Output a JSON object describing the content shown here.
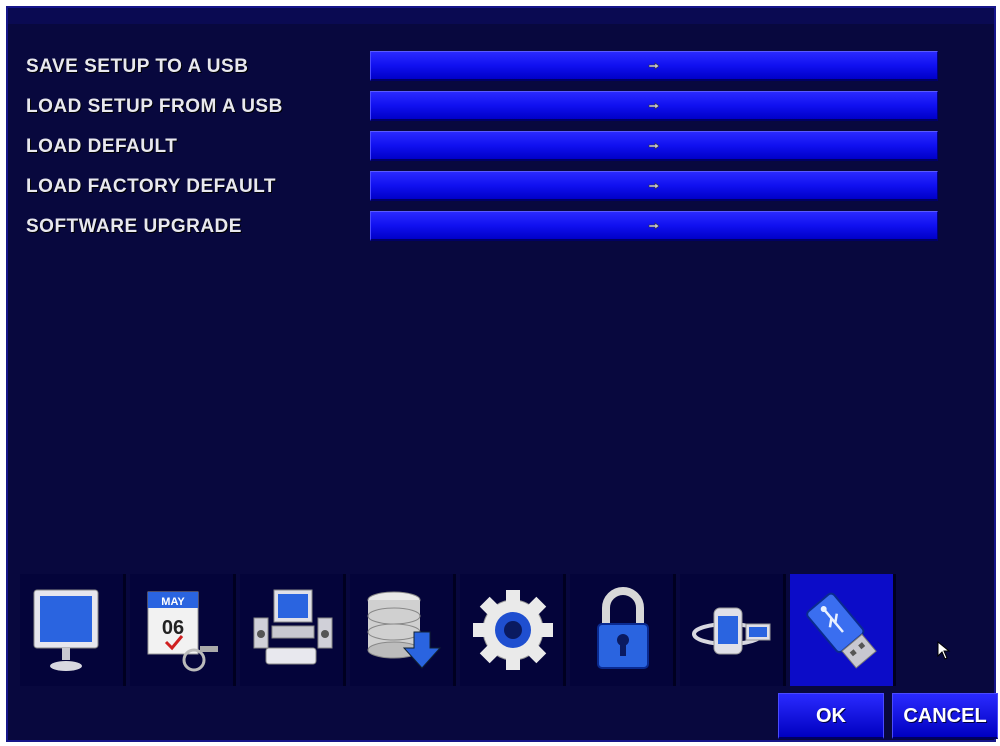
{
  "colors": {
    "background": "#08083e",
    "button": "#1010f0",
    "label": "#e8e8ee",
    "active_tab": "#0c0cc8"
  },
  "rows": [
    {
      "label": "SAVE SETUP TO A USB",
      "icon": "hand-pointer-icon"
    },
    {
      "label": "LOAD SETUP FROM A USB",
      "icon": "hand-pointer-icon"
    },
    {
      "label": "LOAD DEFAULT",
      "icon": "hand-pointer-icon"
    },
    {
      "label": "LOAD FACTORY DEFAULT",
      "icon": "hand-pointer-icon"
    },
    {
      "label": "SOFTWARE UPGRADE",
      "icon": "hand-pointer-icon"
    }
  ],
  "toolbar": {
    "tabs": [
      {
        "icon": "monitor-icon"
      },
      {
        "icon": "calendar-icon",
        "month": "MAY",
        "day": "06"
      },
      {
        "icon": "computer-speakers-icon"
      },
      {
        "icon": "database-download-icon"
      },
      {
        "icon": "gear-icon"
      },
      {
        "icon": "padlock-icon"
      },
      {
        "icon": "network-globe-icon"
      },
      {
        "icon": "usb-drive-icon",
        "active": true
      }
    ]
  },
  "footer": {
    "ok_label": "OK",
    "cancel_label": "CANCEL"
  }
}
